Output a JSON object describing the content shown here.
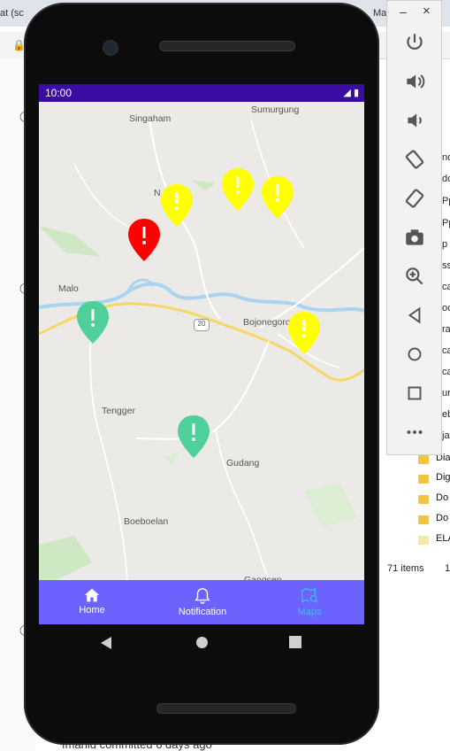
{
  "background": {
    "tab1": "at (sc",
    "tab2": "Ma",
    "status_row_char": "r",
    "bottom_text": "fmanid committed 6 days ago"
  },
  "phone": {
    "status_time": "10:00",
    "map_labels": {
      "singaham": "Singaham",
      "sumurgung": "Sumurgung",
      "n": "N",
      "malo": "Malo",
      "bojonegoro": "Bojonegoro",
      "route_number": "20",
      "tengger": "Tengger",
      "gudang": "Gudang",
      "boeboelan": "Boeboelan",
      "gangsen": "Gangsen"
    },
    "pins": [
      {
        "name": "alert-pin-red",
        "color": "#ff0000"
      },
      {
        "name": "alert-pin-yellow-1",
        "color": "#ffff00"
      },
      {
        "name": "alert-pin-yellow-2",
        "color": "#ffff00"
      },
      {
        "name": "alert-pin-yellow-3",
        "color": "#ffff00"
      },
      {
        "name": "alert-pin-yellow-4",
        "color": "#ffff00"
      },
      {
        "name": "alert-pin-green-1",
        "color": "#4fcf99"
      },
      {
        "name": "alert-pin-green-2",
        "color": "#4fcf99"
      }
    ],
    "bottom_nav": {
      "home_label": "Home",
      "notification_label": "Notification",
      "maps_label": "Maps"
    },
    "colors": {
      "status_bar": "#3a0ca3",
      "nav_bar": "#6c63ff",
      "nav_active": "#3fb8f0"
    }
  },
  "emulator_toolbar": {
    "minimize_label": "–",
    "close_label": "×",
    "icons": [
      "power-icon",
      "volume-up-icon",
      "volume-down-icon",
      "rotate-left-icon",
      "rotate-right-icon",
      "camera-icon",
      "zoom-icon",
      "back-icon",
      "home-icon",
      "overview-icon",
      "more-icon"
    ]
  },
  "explorer": {
    "items": [
      "Dia",
      "Dig",
      "Do",
      "Do",
      "ELA"
    ],
    "item_count": "71 items",
    "right_fragment": "1"
  },
  "side_fragments": [
    "no",
    "do",
    "Pp",
    "Pp",
    "p",
    "ss",
    "ca",
    "oc",
    "ra",
    "ca",
    "ca",
    "ur",
    "eb",
    "ja"
  ]
}
